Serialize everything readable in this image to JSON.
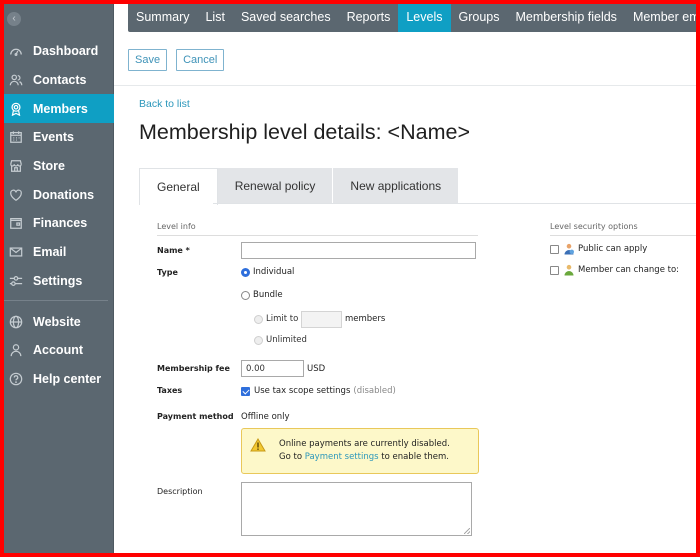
{
  "sidebar": {
    "collapse_icon": "chevron-left-icon",
    "items": [
      {
        "label": "Dashboard",
        "icon": "dashboard-icon",
        "active": false
      },
      {
        "label": "Contacts",
        "icon": "contacts-icon",
        "active": false
      },
      {
        "label": "Members",
        "icon": "members-icon",
        "active": true
      },
      {
        "label": "Events",
        "icon": "calendar-icon",
        "active": false
      },
      {
        "label": "Store",
        "icon": "store-icon",
        "active": false
      },
      {
        "label": "Donations",
        "icon": "heart-icon",
        "active": false
      },
      {
        "label": "Finances",
        "icon": "wallet-icon",
        "active": false
      },
      {
        "label": "Email",
        "icon": "envelope-icon",
        "active": false
      },
      {
        "label": "Settings",
        "icon": "sliders-icon",
        "active": false
      }
    ],
    "secondary_items": [
      {
        "label": "Website",
        "icon": "globe-icon"
      },
      {
        "label": "Account",
        "icon": "user-icon"
      },
      {
        "label": "Help center",
        "icon": "help-icon"
      }
    ]
  },
  "topnav": {
    "items": [
      {
        "label": "Summary",
        "active": false
      },
      {
        "label": "List",
        "active": false
      },
      {
        "label": "Saved searches",
        "active": false
      },
      {
        "label": "Reports",
        "active": false
      },
      {
        "label": "Levels",
        "active": true
      },
      {
        "label": "Groups",
        "active": false
      },
      {
        "label": "Membership fields",
        "active": false
      },
      {
        "label": "Member emails",
        "active": false
      }
    ]
  },
  "toolbar": {
    "save_label": "Save",
    "cancel_label": "Cancel"
  },
  "page": {
    "back_link": "Back to list",
    "title": "Membership level details: <Name>",
    "tabs": [
      {
        "label": "General",
        "active": true
      },
      {
        "label": "Renewal policy",
        "active": false
      },
      {
        "label": "New applications",
        "active": false
      }
    ]
  },
  "form": {
    "level_info_label": "Level info",
    "name_label": "Name *",
    "name_value": "",
    "type_label": "Type",
    "type_options": [
      {
        "label": "Individual",
        "checked": true
      },
      {
        "label": "Bundle",
        "checked": false
      }
    ],
    "bundle_limit_label": "Limit to",
    "bundle_limit_value": "",
    "bundle_members_label": "members",
    "bundle_unlimited_label": "Unlimited",
    "fee_label": "Membership fee",
    "fee_value": "0.00",
    "fee_currency": "USD",
    "taxes_label": "Taxes",
    "taxes_option": "Use tax scope settings",
    "taxes_checked": true,
    "taxes_note": "(disabled)",
    "payment_label": "Payment method",
    "payment_value": "Offline only",
    "alert": {
      "icon": "warning-icon",
      "line1": "Online payments are currently disabled.",
      "line2_prefix": "Go to",
      "line2_link": "Payment settings",
      "line2_suffix": "to enable them."
    },
    "description_label": "Description",
    "description_value": ""
  },
  "security": {
    "label": "Level security options",
    "options": [
      {
        "label": "Public can apply",
        "checked": false,
        "icon": "public-user-icon"
      },
      {
        "label": "Member can change to:",
        "checked": false,
        "icon": "member-user-icon"
      }
    ]
  },
  "colors": {
    "accent": "#0f9fc4",
    "sidebar_bg": "#5b6770",
    "alert_bg": "#fdf8c9",
    "alert_border": "#e9c85a",
    "link": "#2c97bb"
  }
}
